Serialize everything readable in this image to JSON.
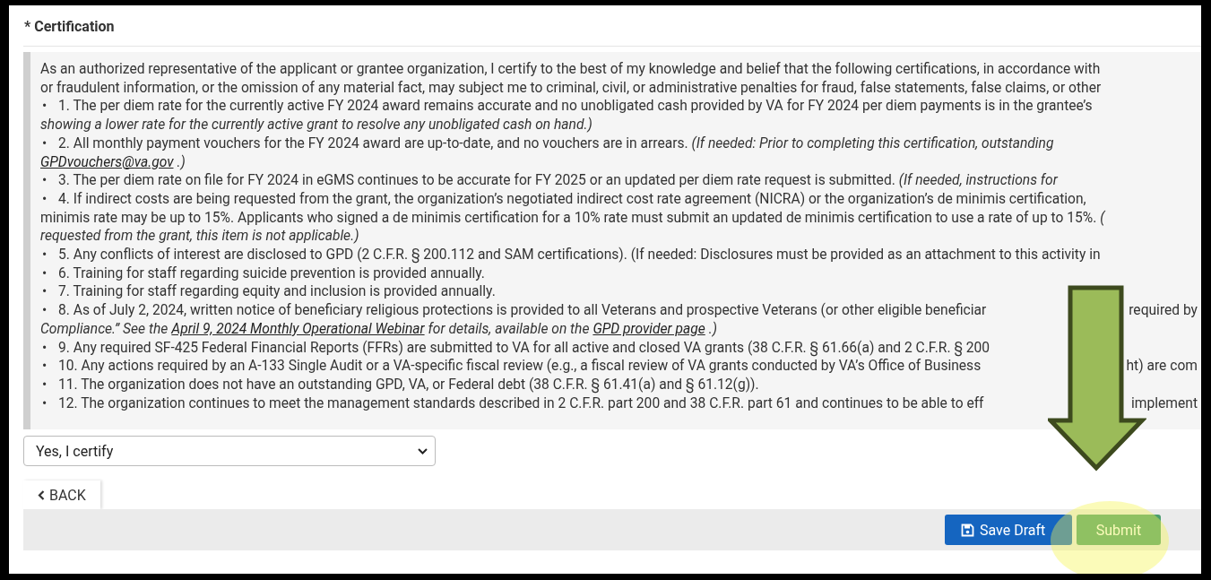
{
  "section_title": "* Certification",
  "intro": [
    "As an authorized representative of the applicant or grantee organization, I certify to the best of my knowledge and belief that the following certifications, in accordance with",
    "or fraudulent information, or the omission of any material fact, may subject me to criminal, civil, or administrative penalties for fraud, false statements, false claims, or other"
  ],
  "items": [
    {
      "bullet": "•",
      "lines": [
        {
          "left": [
            {
              "kind": "plain",
              "text": "1. The per diem rate for the currently active FY 2024 award remains accurate and no unobligated cash provided by VA for FY 2024 per diem payments is in the grantee’s"
            }
          ]
        },
        {
          "left": [
            {
              "kind": "italic",
              "text": "showing a lower rate for the currently active grant to resolve any unobligated cash on hand.)"
            }
          ]
        }
      ]
    },
    {
      "bullet": "•",
      "lines": [
        {
          "left": [
            {
              "kind": "plain",
              "text": "2. All monthly payment vouchers for the FY 2024 award are up-to-date, and no vouchers are in arrears."
            },
            {
              "kind": "italic",
              "text": "(If needed: Prior to completing this certification, outstanding"
            }
          ]
        },
        {
          "left": [
            {
              "kind": "link",
              "text": "GPDvouchers@va.gov"
            },
            {
              "kind": "italic",
              "text": ".)"
            }
          ]
        }
      ]
    },
    {
      "bullet": "•",
      "lines": [
        {
          "left": [
            {
              "kind": "plain",
              "text": "3. The per diem rate on file for FY 2024 in eGMS continues to be accurate for FY 2025 or an updated per diem rate request is submitted."
            },
            {
              "kind": "italic",
              "text": "(If needed, instructions for"
            }
          ]
        }
      ]
    },
    {
      "bullet": "•",
      "lines": [
        {
          "left": [
            {
              "kind": "plain",
              "text": "4. If indirect costs are being requested from the grant, the organization’s negotiated indirect cost rate agreement (NICRA) or the organization’s de minimis certification,"
            }
          ]
        },
        {
          "left": [
            {
              "kind": "plain",
              "text": "minimis rate may be up to 15%. Applicants who signed a de minimis certification for a 10% rate must submit an updated de minimis certification to use a rate of up to 15%."
            },
            {
              "kind": "italic",
              "text": "("
            }
          ]
        },
        {
          "left": [
            {
              "kind": "italic",
              "text": "requested from the grant, this item is not applicable.)"
            }
          ]
        }
      ]
    },
    {
      "bullet": "•",
      "lines": [
        {
          "left": [
            {
              "kind": "plain",
              "text": "5. Any conflicts of interest are disclosed to GPD (2 C.F.R. § 200.112 and SAM certifications). (If needed: Disclosures must be provided as an attachment to this activity in"
            }
          ]
        }
      ]
    },
    {
      "bullet": "•",
      "lines": [
        {
          "left": [
            {
              "kind": "plain",
              "text": "6. Training for staff regarding suicide prevention is provided annually."
            }
          ]
        }
      ]
    },
    {
      "bullet": "•",
      "lines": [
        {
          "left": [
            {
              "kind": "plain",
              "text": "7. Training for staff regarding equity and inclusion is provided annually."
            }
          ]
        }
      ]
    },
    {
      "bullet": "•",
      "lines": [
        {
          "left": [
            {
              "kind": "plain",
              "text": "8. As of July 2, 2024, written notice of beneficiary religious protections is provided to all Veterans and prospective Veterans (or other eligible beneficiar"
            }
          ],
          "right": [
            {
              "kind": "plain",
              "text": "required by"
            }
          ]
        },
        {
          "left": [
            {
              "kind": "italic",
              "text": "Compliance.” See the"
            },
            {
              "kind": "link",
              "text": "April 9, 2024 Monthly Operational Webinar"
            },
            {
              "kind": "italic",
              "text": "for details, available on the"
            },
            {
              "kind": "link",
              "text": "GPD provider page"
            },
            {
              "kind": "italic",
              "text": ".)"
            }
          ]
        }
      ]
    },
    {
      "bullet": "•",
      "lines": [
        {
          "left": [
            {
              "kind": "plain",
              "text": "9. Any required SF-425 Federal Financial Reports (FFRs) are submitted to VA for all active and closed VA grants (38 C.F.R. § 61.66(a) and 2 C.F.R. § 200"
            }
          ]
        }
      ]
    },
    {
      "bullet": "•",
      "lines": [
        {
          "left": [
            {
              "kind": "plain",
              "text": "10. Any actions required by an A-133 Single Audit or a VA-specific fiscal review (e.g., a fiscal review of VA grants conducted by VA’s Office of Business"
            }
          ],
          "right": [
            {
              "kind": "plain",
              "text": "ht) are com"
            }
          ]
        }
      ]
    },
    {
      "bullet": "•",
      "lines": [
        {
          "left": [
            {
              "kind": "plain",
              "text": "11. The organization does not have an outstanding GPD, VA, or Federal debt (38 C.F.R. § 61.41(a) and § 61.12(g))."
            }
          ]
        }
      ]
    },
    {
      "bullet": "•",
      "lines": [
        {
          "left": [
            {
              "kind": "plain",
              "text": "12. The organization continues to meet the management standards described in 2 C.F.R. part 200 and 38 C.F.R. part 61 and continues to be able to eff"
            }
          ],
          "right": [
            {
              "kind": "plain",
              "text": "implement"
            }
          ]
        }
      ]
    }
  ],
  "certify_select": {
    "value": "Yes, I certify"
  },
  "back_button": {
    "label": "BACK"
  },
  "footer_buttons": [
    {
      "kind": "save",
      "label": "Save Draft"
    },
    {
      "kind": "submit",
      "label": "Submit"
    }
  ]
}
